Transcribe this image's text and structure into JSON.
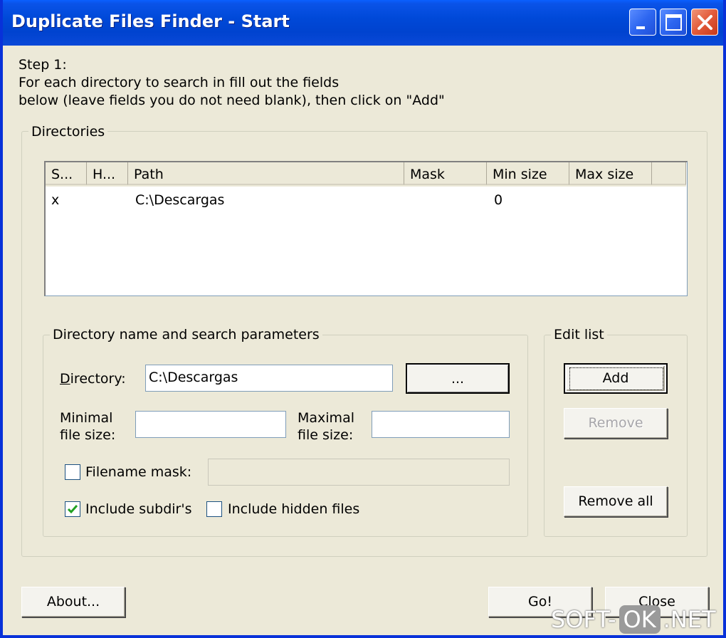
{
  "window": {
    "title": "Duplicate Files Finder - Start"
  },
  "instructions": {
    "line1": "Step 1:",
    "line2": "For each directory to search in fill out the fields",
    "line3": "below (leave fields you do not need blank), then click on \"Add\""
  },
  "directories_group": {
    "legend": "Directories",
    "columns": [
      "S...",
      "H...",
      "Path",
      "Mask",
      "Min size",
      "Max size"
    ],
    "rows": [
      {
        "s": "x",
        "h": "",
        "path": "C:\\Descargas",
        "mask": "",
        "min_size": "0",
        "max_size": ""
      }
    ]
  },
  "params_group": {
    "legend": "Directory name and search parameters",
    "directory_label": "Directory:",
    "directory_value": "C:\\Descargas",
    "browse_label": "...",
    "minimal_label_1": "Minimal",
    "minimal_label_2": "file size:",
    "minimal_value": "",
    "maximal_label_1": "Maximal",
    "maximal_label_2": "file size:",
    "maximal_value": "",
    "filename_mask_label": "Filename mask:",
    "filename_mask_checked": false,
    "filename_mask_value": "",
    "include_subdirs_label": "Include subdir's",
    "include_subdirs_checked": true,
    "include_hidden_label": "Include hidden files",
    "include_hidden_checked": false
  },
  "edit_list_group": {
    "legend": "Edit list",
    "add_label": "Add",
    "remove_label": "Remove",
    "remove_all_label": "Remove all"
  },
  "footer": {
    "about_label": "About...",
    "go_label": "Go!",
    "close_label": "Close"
  },
  "watermark": {
    "part1": "SOFT-",
    "part2": "OK",
    "part3": ".NET"
  },
  "colors": {
    "titlebar": "#0a53e8",
    "window_bg": "#ece9d8",
    "close_button": "#e25a3a"
  }
}
